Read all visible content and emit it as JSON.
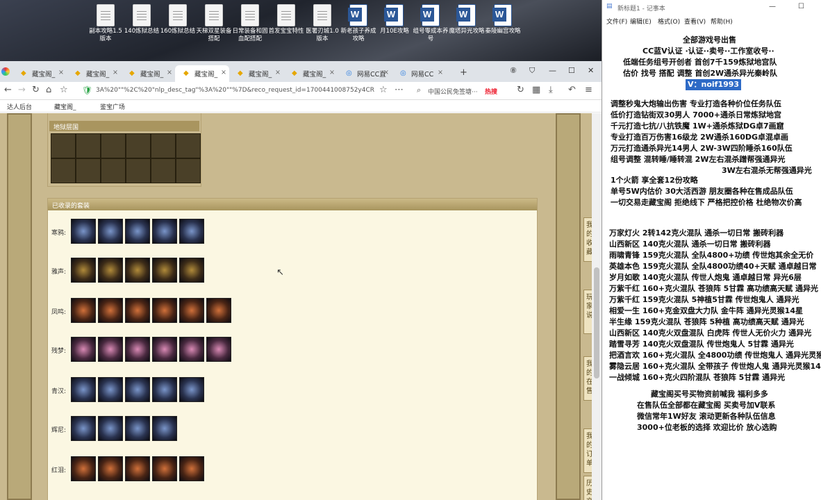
{
  "desktop": {
    "icons": [
      {
        "label": "副本攻略1.5版本",
        "type": "txt"
      },
      {
        "label": "140炼狱总结",
        "type": "txt"
      },
      {
        "label": "160炼狱总结",
        "type": "txt"
      },
      {
        "label": "天梯双星装备搭配",
        "type": "txt"
      },
      {
        "label": "日常装备和固血配搭配",
        "type": "txt"
      },
      {
        "label": "首发宝宝特性",
        "type": "txt"
      },
      {
        "label": "医署刃城1.0版本",
        "type": "txt"
      },
      {
        "label": "新老孩子养成攻略",
        "type": "doc"
      },
      {
        "label": "月10E攻略",
        "type": "doc"
      },
      {
        "label": "组号零成本养号",
        "type": "doc"
      },
      {
        "label": "魔塔异光攻略",
        "type": "doc"
      },
      {
        "label": "秦陵幽宫攻略",
        "type": "doc"
      }
    ]
  },
  "browser": {
    "tabs": [
      "藏宝阁_",
      "藏宝阁_",
      "藏宝阁_",
      "藏宝阁_",
      "藏宝阁_",
      "藏宝阁_",
      "网易CC直",
      "网易CC"
    ],
    "new_tab": "+",
    "address": "3A%20\"\"%2C%20\"nlp_desc_tag\"%3A%20\"\"%7D&reco_request_id=1700441008752y4CR",
    "search_text": "中国公民免签塘···",
    "hot_label": "热搜",
    "bookmarks": [
      "达人后台",
      "藏宝阁_",
      "鉴宝广场"
    ]
  },
  "game": {
    "storage_title": "地狱层国",
    "collected_title": "已收录的套装",
    "sets": [
      {
        "name": "寒鸦:",
        "count": 5
      },
      {
        "name": "雅声:",
        "count": 5
      },
      {
        "name": "凤鸣:",
        "count": 6
      },
      {
        "name": "残梦:",
        "count": 6
      },
      {
        "name": "青汉:",
        "count": 5
      },
      {
        "name": "辉尼:",
        "count": 4
      },
      {
        "name": "红泪:",
        "count": 5
      }
    ],
    "side_buttons": [
      "我的收藏",
      "玩家说",
      "我的在售",
      "我的订单",
      "历史交"
    ]
  },
  "notepad": {
    "title": "新标题1 - 记事本",
    "menu": [
      "文件(F)",
      "编辑(E)",
      "格式(O)",
      "查看(V)",
      "帮助(H)"
    ],
    "lines": [
      "全部游戏号出售",
      "CC蓝V认证 ·认证··卖号··工作室收号··",
      "低端任务组号开创者    首创7千159炼狱地宫队",
      "估价 找号 搭配 调整    首创2W通杀异光秦岭队",
      "V：noif1993",
      "调整秒鬼大炮输出伤害      专业打造各种价位任务队伍",
      "低价打造钻街双30男人      7000+通杀日常炼狱地宫",
      "千元打造七抗/八抗铁魔    1W+通杀炼狱DG卓7画窟",
      "专业打造百万伤害16级龙    2W通杀160DG卓混卓画",
      "万元打造通杀异光14男人    2W-3W四阶睡杀160队伍",
      "组号调整 混转睡/睡转混    2W左右混杀蹭帮强通异光",
      "3W左右混杀无帮强通异光",
      "1个火箭 享全套12份攻略",
      "单号5W内估价 30大活西游       朋友圈各种在售成品队伍",
      "一切交易走藏宝阁 拒绝线下    严格把控价格 杜绝物次价高",
      "万家灯火 2转142克火混队 通杀一切日常 搬砖利器",
      "山西新区 140克火混队 通杀一切日常 搬砖利器",
      "雨啸青锋 159克火混队 全队4800+功绩 传世炮其余全无价",
      "英雄本色 159克火混队 全队4800功绩40+天赋 通卓越日常",
      "岁月如歌 140克火混队 传世人炮鬼 通卓越日常 异光6层",
      "万紫千红 160+克火混队 苍狼阵 5甘霖 高功绩高天赋 通异光",
      "万紫千红 159克火混队 5神植5甘霖 传世炮鬼人 通异光",
      "相爱一生 160+克金双盘大力队 金牛阵 通异光灵猴14星",
      "半生缘  159克火混队 苍狼阵 5种植 高功绩高天赋 通异光",
      "山西新区 140克火双盘混队 白虎阵 传世人无价火力 通异光",
      "踏雪寻芳 140克火双盘混队 传世炮鬼人 5甘霖 通异光",
      "把酒言欢 160+克火混队 全4800功绩 传世炮鬼人 通异光灵猴",
      "雾隐云居 160+克火混队 全带孩子 传世炮人鬼 通异光灵猴14",
      "一战倾城 160+克火四阶混队 苍狼阵 5甘霖 通异光",
      "藏宝阁买号买物资前喊我 福利多多",
      "在售队伍全部都在藏宝阁 买卖号加V联系",
      "微信常年1W好友 滚动更新各种队伍信息",
      "3000+位老板的选择 欢迎比价 放心选购"
    ]
  }
}
